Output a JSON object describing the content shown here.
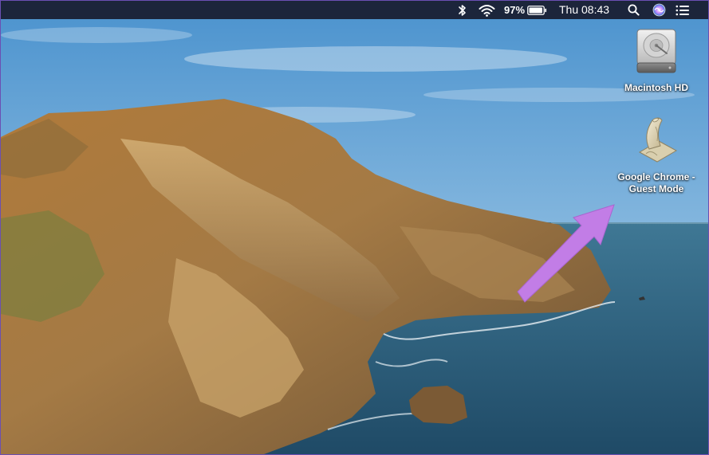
{
  "menubar": {
    "icons": [
      "bluetooth-icon",
      "wifi-icon",
      "battery-icon",
      "search-icon",
      "siri-icon",
      "control-center-icon"
    ],
    "battery_percent": "97%",
    "battery_level": 0.97,
    "clock": "Thu 08:43"
  },
  "desktop": {
    "icons": [
      {
        "label": "Macintosh HD",
        "icon": "hard-drive-icon"
      },
      {
        "label": "Google Chrome -",
        "label_line2": "Guest Mode",
        "icon": "script-icon"
      }
    ],
    "annotation_color": "#c27de6"
  }
}
